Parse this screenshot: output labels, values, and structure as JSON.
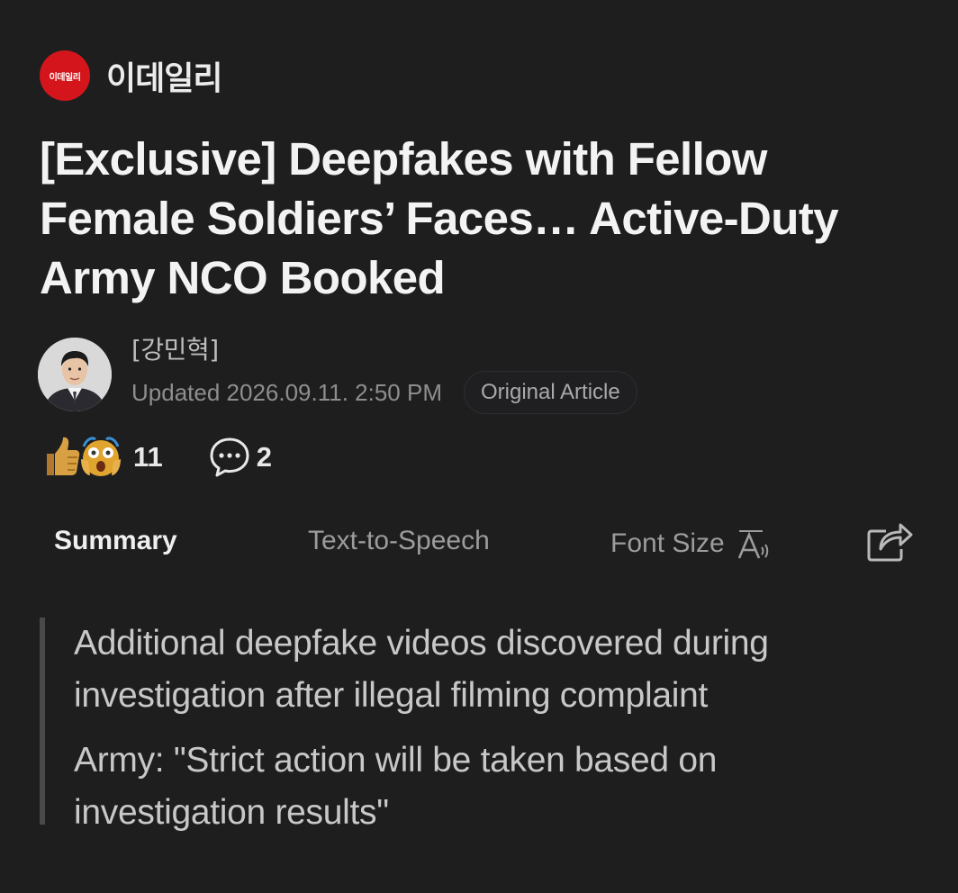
{
  "publisher": {
    "logo_text": "이데일리",
    "name": "이데일리"
  },
  "headline": "[Exclusive] Deepfakes with Fellow Female Soldiers’ Faces… Active-Duty Army NCO Booked",
  "author": {
    "name": "[강민혁]",
    "updated": "Updated 2026.09.11. 2:50 PM",
    "original_article_label": "Original Article"
  },
  "reactions": {
    "count": "11",
    "comment_count": "2",
    "emojis": [
      "thumbs-up-icon",
      "shocked-face-icon"
    ]
  },
  "toolbar": {
    "summary_label": "Summary",
    "tts_label": "Text-to-Speech",
    "font_size_label": "Font Size"
  },
  "summary": {
    "lines": [
      "Additional deepfake videos discovered during investigation after illegal filming complaint",
      "Army: \"Strict action will be taken based on investigation results\""
    ]
  },
  "colors": {
    "background": "#1e1e1f",
    "brand_red": "#d4151c",
    "headline": "#f3f3f3",
    "muted": "#8e8e8e",
    "summary_bar": "#4a4a4c"
  }
}
